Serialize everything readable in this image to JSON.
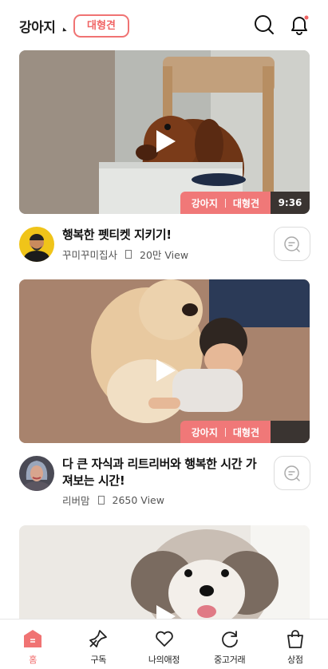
{
  "header": {
    "category": "강아지",
    "chip": "대형견",
    "icons": [
      "search-icon",
      "bell-icon"
    ]
  },
  "feed": [
    {
      "tags": [
        "강아지",
        "대형견"
      ],
      "duration": "9:36",
      "title": "행복한 펫티켓 지키기!",
      "author": "꾸미꾸미집사",
      "views": "20만 View"
    },
    {
      "tags": [
        "강아지",
        "대형견"
      ],
      "duration": "",
      "title": "다 큰 자식과 리트리버와 행복한 시간 가져보는 시간!",
      "author": "리버맘",
      "views": "2650 View"
    }
  ],
  "tabbar": {
    "items": [
      {
        "label": "홈",
        "icon": "home-icon",
        "active": true
      },
      {
        "label": "구독",
        "icon": "pin-icon",
        "active": false
      },
      {
        "label": "나의애정",
        "icon": "heart-icon",
        "active": false
      },
      {
        "label": "중고거래",
        "icon": "refresh-icon",
        "active": false
      },
      {
        "label": "상점",
        "icon": "bag-icon",
        "active": false
      }
    ]
  },
  "colors": {
    "accent": "#f06464",
    "badge": "#f07878",
    "duration_bg": "#3a3431"
  }
}
